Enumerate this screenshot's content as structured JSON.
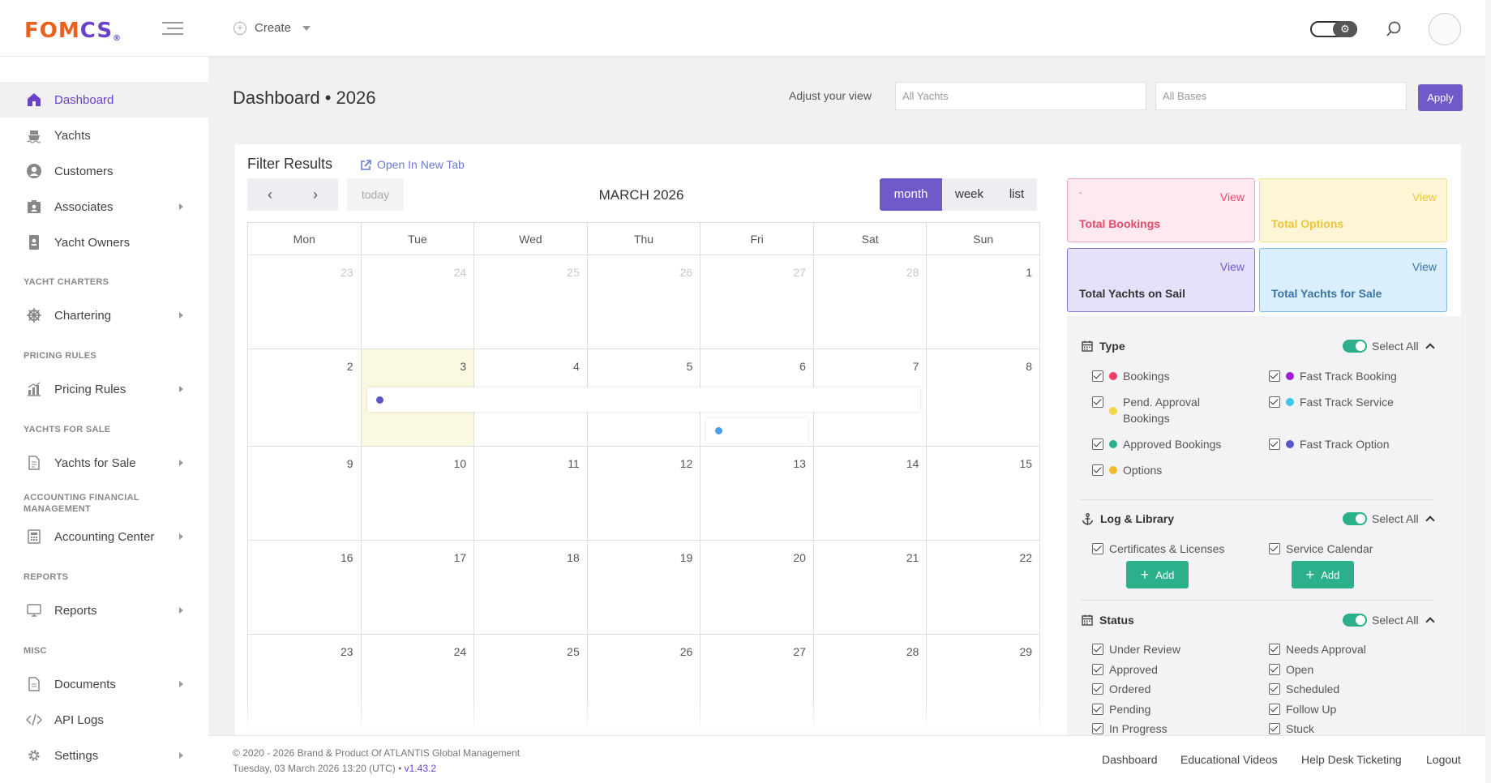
{
  "brand": {
    "logo_main": "FOM",
    "logo_accent": "CS",
    "logo_mark": "®"
  },
  "topbar": {
    "create_label": "Create"
  },
  "sidebar": {
    "items": [
      {
        "label": "Dashboard",
        "icon": "home-icon"
      },
      {
        "label": "Yachts",
        "icon": "ship-icon"
      },
      {
        "label": "Customers",
        "icon": "user-circle-icon"
      },
      {
        "label": "Associates",
        "icon": "id-card-icon"
      },
      {
        "label": "Yacht Owners",
        "icon": "id-badge-icon"
      },
      {
        "label": "Chartering",
        "icon": "helm-icon"
      },
      {
        "label": "Pricing Rules",
        "icon": "chart-icon"
      },
      {
        "label": "Yachts for Sale",
        "icon": "document-icon"
      },
      {
        "label": "Accounting Center",
        "icon": "calculator-icon"
      },
      {
        "label": "Reports",
        "icon": "monitor-icon"
      },
      {
        "label": "Documents",
        "icon": "file-icon"
      },
      {
        "label": "API Logs",
        "icon": "code-icon"
      },
      {
        "label": "Settings",
        "icon": "gear-icon"
      }
    ],
    "sections": {
      "yacht_charters": "YACHT CHARTERS",
      "pricing_rules": "PRICING RULES",
      "yachts_for_sale": "YACHTS FOR SALE",
      "accounting": "ACCOUNTING FINANCIAL MANAGEMENT",
      "reports": "REPORTS",
      "misc": "MISC"
    }
  },
  "header": {
    "title": "Dashboard • 2026",
    "adjust_label": "Adjust your view",
    "yachts_placeholder": "All Yachts",
    "bases_placeholder": "All Bases",
    "apply_label": "Apply"
  },
  "filter": {
    "title": "Filter Results",
    "open_new_tab": "Open In New Tab"
  },
  "calendar": {
    "title": "MARCH 2026",
    "today_label": "today",
    "views": [
      "month",
      "week",
      "list"
    ],
    "active_view": "month",
    "weekdays": [
      "Mon",
      "Tue",
      "Wed",
      "Thu",
      "Fri",
      "Sat",
      "Sun"
    ],
    "weeks": [
      [
        {
          "d": "23",
          "dim": true
        },
        {
          "d": "24",
          "dim": true
        },
        {
          "d": "25",
          "dim": true
        },
        {
          "d": "26",
          "dim": true
        },
        {
          "d": "27",
          "dim": true
        },
        {
          "d": "28",
          "dim": true
        },
        {
          "d": "1"
        }
      ],
      [
        {
          "d": "2"
        },
        {
          "d": "3",
          "today": true
        },
        {
          "d": "4"
        },
        {
          "d": "5"
        },
        {
          "d": "6"
        },
        {
          "d": "7"
        },
        {
          "d": "8"
        }
      ],
      [
        {
          "d": "9"
        },
        {
          "d": "10"
        },
        {
          "d": "11"
        },
        {
          "d": "12"
        },
        {
          "d": "13"
        },
        {
          "d": "14"
        },
        {
          "d": "15"
        }
      ],
      [
        {
          "d": "16"
        },
        {
          "d": "17"
        },
        {
          "d": "18"
        },
        {
          "d": "19"
        },
        {
          "d": "20"
        },
        {
          "d": "21"
        },
        {
          "d": "22"
        }
      ],
      [
        {
          "d": "23"
        },
        {
          "d": "24"
        },
        {
          "d": "25"
        },
        {
          "d": "26"
        },
        {
          "d": "27"
        },
        {
          "d": "28"
        },
        {
          "d": "29"
        }
      ]
    ],
    "event_colors": [
      "#5a56c9",
      "#4a9fe8"
    ]
  },
  "stats": [
    {
      "label": "Total Bookings",
      "view": "View",
      "small": "-",
      "bg": "#fde9ee",
      "border": "#f2a6ba",
      "color": "#e34b6f"
    },
    {
      "label": "Total Options",
      "view": "View",
      "small": "",
      "bg": "#fdf6d6",
      "border": "#f1de8a",
      "color": "#eac43a"
    },
    {
      "label": "Total Yachts on Sail",
      "view": "View",
      "small": "",
      "bg": "#e6e1fb",
      "border": "#8d77d6",
      "color": "#333333",
      "view_color": "#7059c9"
    },
    {
      "label": "Total Yachts for Sale",
      "view": "View",
      "small": "",
      "bg": "#dbeefb",
      "border": "#7cb8e8",
      "color": "#3a74a8",
      "view_color": "#3a74a8"
    }
  ],
  "panel": {
    "type": {
      "title": "Type",
      "select_all": "Select All",
      "items": [
        {
          "label": "Bookings",
          "color": "#ee3f62"
        },
        {
          "label": "Fast Track Booking",
          "color": "#9a1fd6"
        },
        {
          "label": "Pend. Approval Bookings",
          "color": "#f3d54a"
        },
        {
          "label": "Fast Track Service",
          "color": "#3cc7e3"
        },
        {
          "label": "Approved Bookings",
          "color": "#2bb08b"
        },
        {
          "label": "Fast Track Option",
          "color": "#5a56c9"
        },
        {
          "label": "Options",
          "color": "#f0b92b"
        }
      ]
    },
    "log": {
      "title": "Log & Library",
      "select_all": "Select All",
      "items": [
        "Certificates & Licenses",
        "Service Calendar"
      ],
      "add_label": "Add"
    },
    "status": {
      "title": "Status",
      "select_all": "Select All",
      "items": [
        "Under Review",
        "Needs Approval",
        "Approved",
        "Open",
        "Ordered",
        "Scheduled",
        "Pending",
        "Follow Up",
        "In Progress",
        "Stuck"
      ]
    }
  },
  "footer": {
    "copyright": "© 2020 - 2026 Brand & Product Of ATLANTIS Global Management",
    "datetime": "Tuesday, 03 March 2026 13:20 (UTC) •",
    "version": "v1.43.2",
    "links": [
      "Dashboard",
      "Educational Videos",
      "Help Desk Ticketing",
      "Logout"
    ]
  }
}
